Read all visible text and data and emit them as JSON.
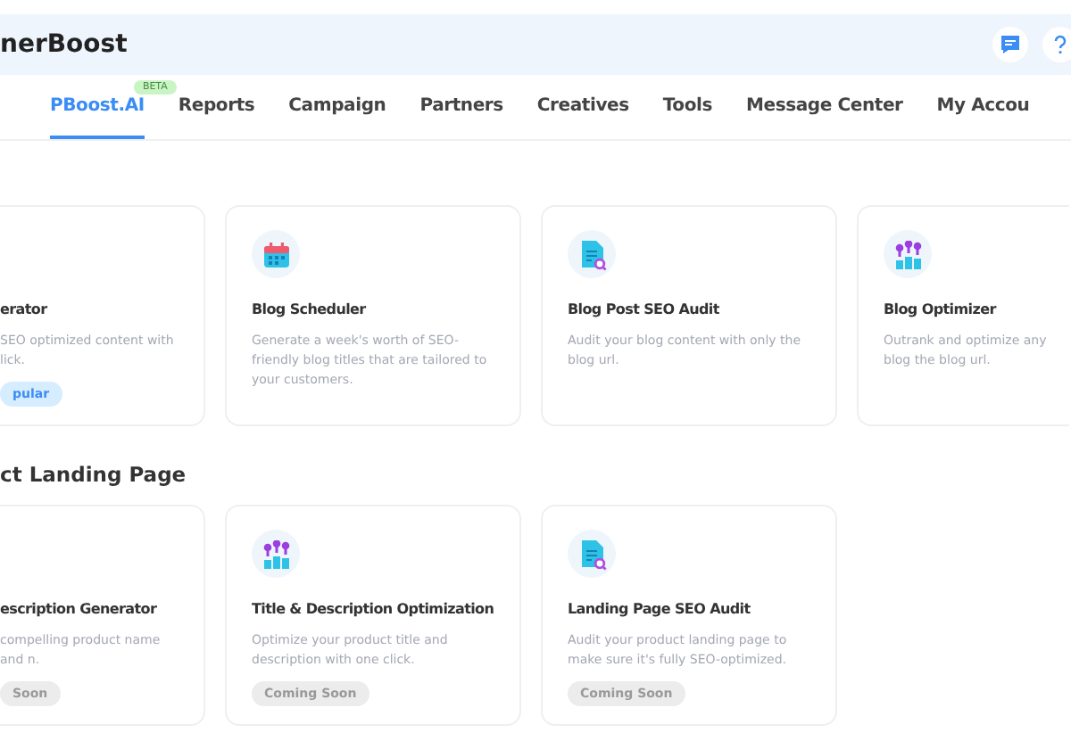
{
  "header": {
    "logo": "nerBoost"
  },
  "nav": [
    {
      "label": "PBoost.AI",
      "selected": true,
      "badge": "BETA"
    },
    {
      "label": "Reports",
      "selected": false
    },
    {
      "label": "Campaign",
      "selected": false
    },
    {
      "label": "Partners",
      "selected": false
    },
    {
      "label": "Creatives",
      "selected": false
    },
    {
      "label": "Tools",
      "selected": false
    },
    {
      "label": "Message Center",
      "selected": false
    },
    {
      "label": "My Accou",
      "selected": false
    }
  ],
  "sections": [
    {
      "cards": [
        {
          "title": "erator",
          "description": "SEO optimized content with lick.",
          "badge": {
            "text": "pular",
            "kind": "popular"
          }
        },
        {
          "kind": "calendar",
          "title": "Blog Scheduler",
          "description": "Generate a week's worth of SEO-friendly blog titles that are tailored to your customers."
        },
        {
          "kind": "audit",
          "title": "Blog Post SEO Audit",
          "description": "Audit your blog content with only the blog url."
        },
        {
          "kind": "optimize",
          "title": "Blog Optimizer",
          "description": "Outrank and optimize any blog the blog url."
        }
      ]
    },
    {
      "title": "ct Landing Page",
      "cards": [
        {
          "title": "escription Generator",
          "description": "compelling product name and n.",
          "badge": {
            "text": "Soon",
            "kind": "soon"
          }
        },
        {
          "kind": "optimize",
          "title": "Title & Description Optimization",
          "description": "Optimize your product title and description with one click.",
          "badge": {
            "text": "Coming Soon",
            "kind": "soon"
          }
        },
        {
          "kind": "audit",
          "title": "Landing Page SEO Audit",
          "description": "Audit your product landing page to make sure it's fully SEO-optimized.",
          "badge": {
            "text": "Coming Soon",
            "kind": "soon"
          }
        }
      ]
    }
  ]
}
